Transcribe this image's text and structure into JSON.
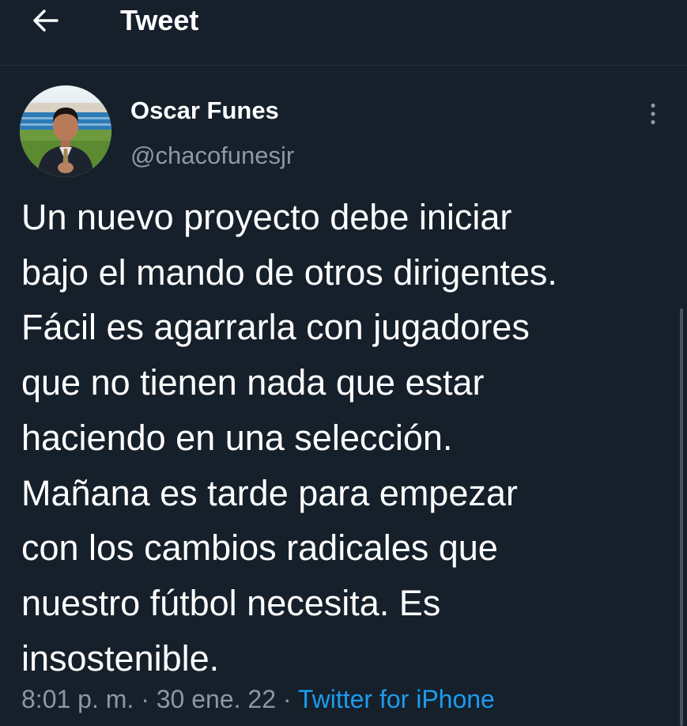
{
  "header": {
    "back_icon": "arrow-left-icon",
    "title": "Tweet"
  },
  "tweet": {
    "author": {
      "display_name": "Oscar Funes",
      "handle": "@chacofunesjr",
      "avatar_icon": "avatar"
    },
    "more_icon": "more-vertical-icon",
    "text": "Un nuevo proyecto debe iniciar\nbajo el mando de otros dirigentes.\nFácil es agarrarla con jugadores\nque no tienen nada que estar\nhaciendo en una selección.\nMañana es tarde para empezar\ncon los cambios radicales que\nnuestro fútbol necesita. Es\ninsostenible.",
    "time": "8:01 p. m.",
    "separator": " · ",
    "date": "30 ene. 22",
    "source": "Twitter for iPhone"
  },
  "colors": {
    "background": "#15202b",
    "text_primary": "#ffffff",
    "text_secondary": "#8b98a5",
    "link": "#1d9bf0"
  }
}
